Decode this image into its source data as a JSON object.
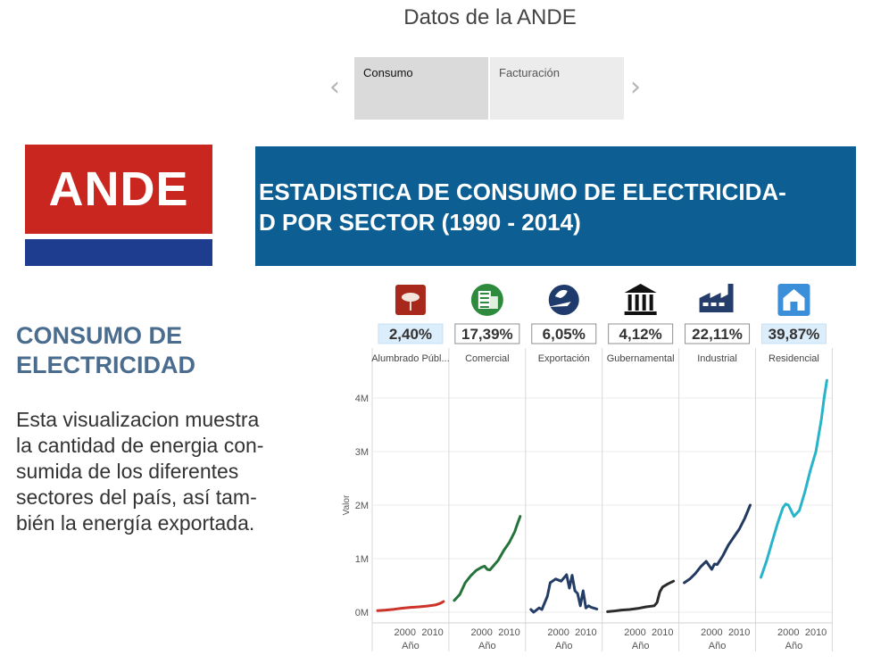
{
  "page": {
    "title": "Datos de la ANDE",
    "tabs": [
      "Consumo",
      "Facturación"
    ]
  },
  "logo": {
    "text": "ANDE"
  },
  "banner": {
    "line1": "ESTADISTICA DE CONSUMO DE ELECTRICIDA-",
    "line2": "D POR SECTOR (1990 - 2014)"
  },
  "side": {
    "title_line1": "CONSUMO DE",
    "title_line2": "ELECTRICIDAD",
    "body_lines": [
      "Esta visualizacion muestra",
      "la cantidad de energia con-",
      "sumida de los diferentes",
      "sectores del país, así tam-",
      "bién la energía exportada."
    ]
  },
  "colors": {
    "banner": "#0d5f93",
    "logo_red": "#c8261e",
    "logo_blue": "#1e3d8f",
    "title_blue": "#4a6c8e"
  },
  "chart_data": {
    "type": "line",
    "ylabel": "Valor",
    "xlabel": "Año",
    "yticks": [
      "0M",
      "1M",
      "2M",
      "3M",
      "4M"
    ],
    "ylim": [
      0,
      4500000
    ],
    "xticks": [
      2000,
      2010
    ],
    "xlim": [
      1990,
      2014
    ],
    "grid": true,
    "series": [
      {
        "name": "Alumbrado Públ...",
        "percent": "2,40%",
        "icon": "street-light-icon",
        "color": "#cc3329",
        "x": [
          1990,
          1993,
          1996,
          1999,
          2002,
          2005,
          2008,
          2011,
          2013,
          2014
        ],
        "values": [
          30000,
          40000,
          55000,
          75000,
          90000,
          100000,
          115000,
          135000,
          170000,
          200000
        ]
      },
      {
        "name": "Comercial",
        "percent": "17,39%",
        "icon": "building-icon",
        "color": "#24733a",
        "x": [
          1990,
          1992,
          1994,
          1996,
          1998,
          2000,
          2001,
          2002,
          2003,
          2004,
          2006,
          2008,
          2010,
          2012,
          2013,
          2014
        ],
        "values": [
          220000,
          330000,
          550000,
          680000,
          780000,
          840000,
          860000,
          800000,
          790000,
          850000,
          970000,
          1150000,
          1300000,
          1500000,
          1650000,
          1790000
        ]
      },
      {
        "name": "Exportación",
        "percent": "6,05%",
        "icon": "export-globe-icon",
        "color": "#233d66",
        "x": [
          1990,
          1991,
          1993,
          1994,
          1996,
          1997,
          1999,
          2001,
          2003,
          2004,
          2005,
          2006,
          2007,
          2008,
          2009,
          2010,
          2011,
          2012,
          2014
        ],
        "values": [
          50000,
          0,
          80000,
          50000,
          300000,
          550000,
          620000,
          580000,
          700000,
          450000,
          690000,
          400000,
          350000,
          120000,
          400000,
          80000,
          120000,
          90000,
          60000
        ]
      },
      {
        "name": "Gubernamental",
        "percent": "4,12%",
        "icon": "government-icon",
        "color": "#2b2b2b",
        "x": [
          1990,
          1992,
          1995,
          1998,
          2001,
          2004,
          2007,
          2008,
          2009,
          2010,
          2012,
          2014
        ],
        "values": [
          10000,
          20000,
          40000,
          50000,
          70000,
          100000,
          120000,
          180000,
          380000,
          470000,
          530000,
          580000
        ]
      },
      {
        "name": "Industrial",
        "percent": "22,11%",
        "icon": "factory-icon",
        "color": "#223a60",
        "x": [
          1990,
          1992,
          1994,
          1996,
          1998,
          2000,
          2001,
          2002,
          2004,
          2006,
          2008,
          2010,
          2012,
          2014
        ],
        "values": [
          550000,
          620000,
          720000,
          850000,
          950000,
          800000,
          900000,
          890000,
          1050000,
          1250000,
          1400000,
          1550000,
          1750000,
          2000000
        ]
      },
      {
        "name": "Residencial",
        "percent": "39,87%",
        "icon": "house-icon",
        "color": "#27b3c8",
        "x": [
          1990,
          1992,
          1994,
          1996,
          1998,
          1999,
          2000,
          2002,
          2004,
          2006,
          2008,
          2010,
          2012,
          2013,
          2014
        ],
        "values": [
          650000,
          950000,
          1300000,
          1650000,
          1950000,
          2020000,
          2000000,
          1790000,
          1900000,
          2250000,
          2650000,
          3000000,
          3600000,
          4000000,
          4330000
        ]
      }
    ]
  }
}
